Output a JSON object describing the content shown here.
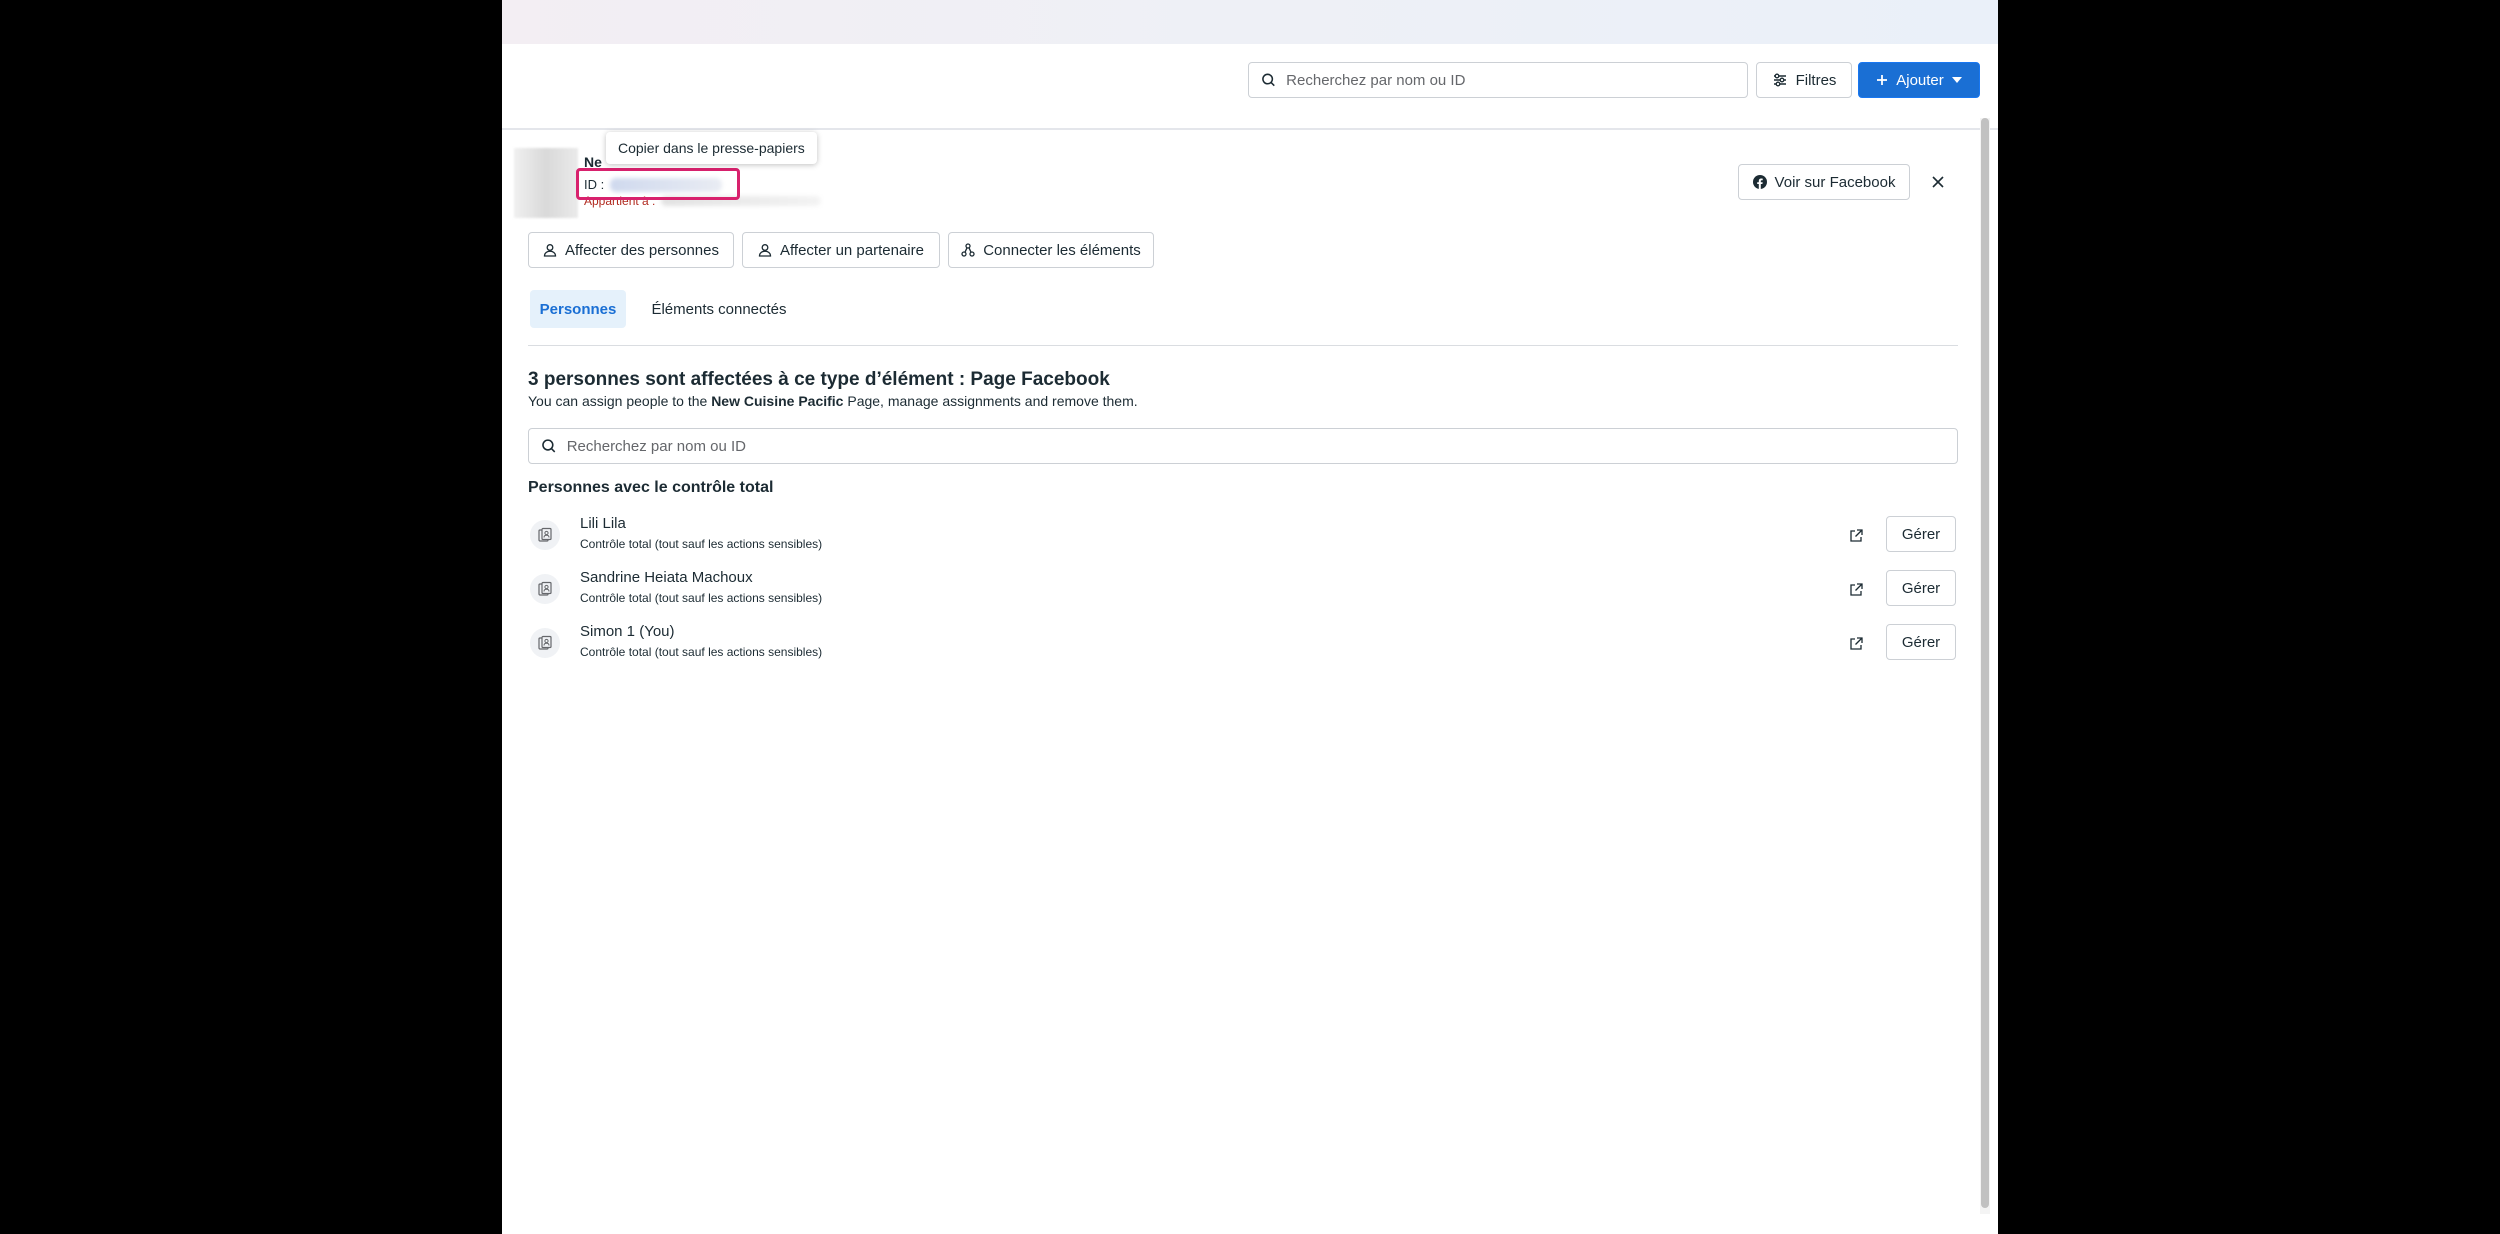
{
  "toolbar": {
    "search_placeholder": "Recherchez par nom ou ID",
    "filters_label": "Filtres",
    "add_label": "Ajouter"
  },
  "asset": {
    "name_stub": "Ne",
    "id_label": "ID :",
    "belongs_label": "Appartient à :",
    "tooltip": "Copier dans le presse-papiers",
    "view_facebook_label": "Voir sur Facebook"
  },
  "actions": [
    {
      "label": "Affecter des personnes",
      "icon": "person-icon"
    },
    {
      "label": "Affecter un partenaire",
      "icon": "partner-icon"
    },
    {
      "label": "Connecter les éléments",
      "icon": "connect-icon"
    }
  ],
  "tabs": [
    {
      "label": "Personnes",
      "active": true
    },
    {
      "label": "Éléments connectés",
      "active": false
    }
  ],
  "section": {
    "title": "3 personnes sont affectées à ce type d’élément : Page Facebook",
    "desc_prefix": "You can assign people to the",
    "desc_bold": "New Cuisine Pacific",
    "desc_suffix": "Page, manage assignments and remove them.",
    "search_placeholder": "Recherchez par nom ou ID",
    "list_title": "Personnes avec le contrôle total"
  },
  "people": [
    {
      "name": "Lili Lila",
      "role": "Contrôle total (tout sauf les actions sensibles)",
      "manage": "Gérer"
    },
    {
      "name": "Sandrine Heiata Machoux",
      "role": "Contrôle total (tout sauf les actions sensibles)",
      "manage": "Gérer"
    },
    {
      "name": "Simon 1 (You)",
      "role": "Contrôle total (tout sauf les actions sensibles)",
      "manage": "Gérer"
    }
  ],
  "colors": {
    "accent": "#1a6fd4",
    "highlight": "#d8216d",
    "tab_active_bg": "#e5f1fb"
  }
}
